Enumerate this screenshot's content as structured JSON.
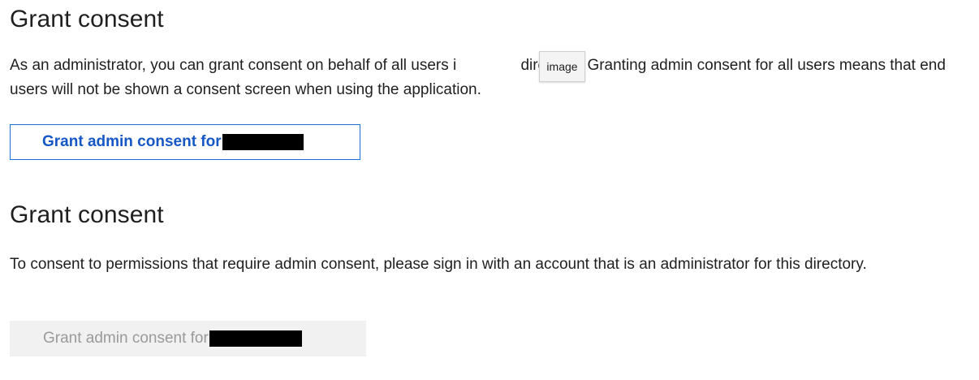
{
  "sections": [
    {
      "heading": "Grant consent",
      "description": "As an administrator, you can grant consent on behalf of all users i               directory. Granting admin consent for all users means that end users will not be shown a consent screen when using the application.",
      "button_label": "Grant admin consent for",
      "button_state": "enabled"
    },
    {
      "heading": "Grant consent",
      "description": "To consent to permissions that require admin consent, please sign in with an account that is an administrator for this directory.",
      "button_label": "Grant admin consent for",
      "button_state": "disabled"
    }
  ],
  "tooltip": "image",
  "colors": {
    "primary_button_text": "#1557c4",
    "primary_button_border": "#1f6fd6",
    "disabled_button_bg": "#f1f1f1",
    "disabled_button_text": "#9a9a9a",
    "redaction": "#000000"
  }
}
